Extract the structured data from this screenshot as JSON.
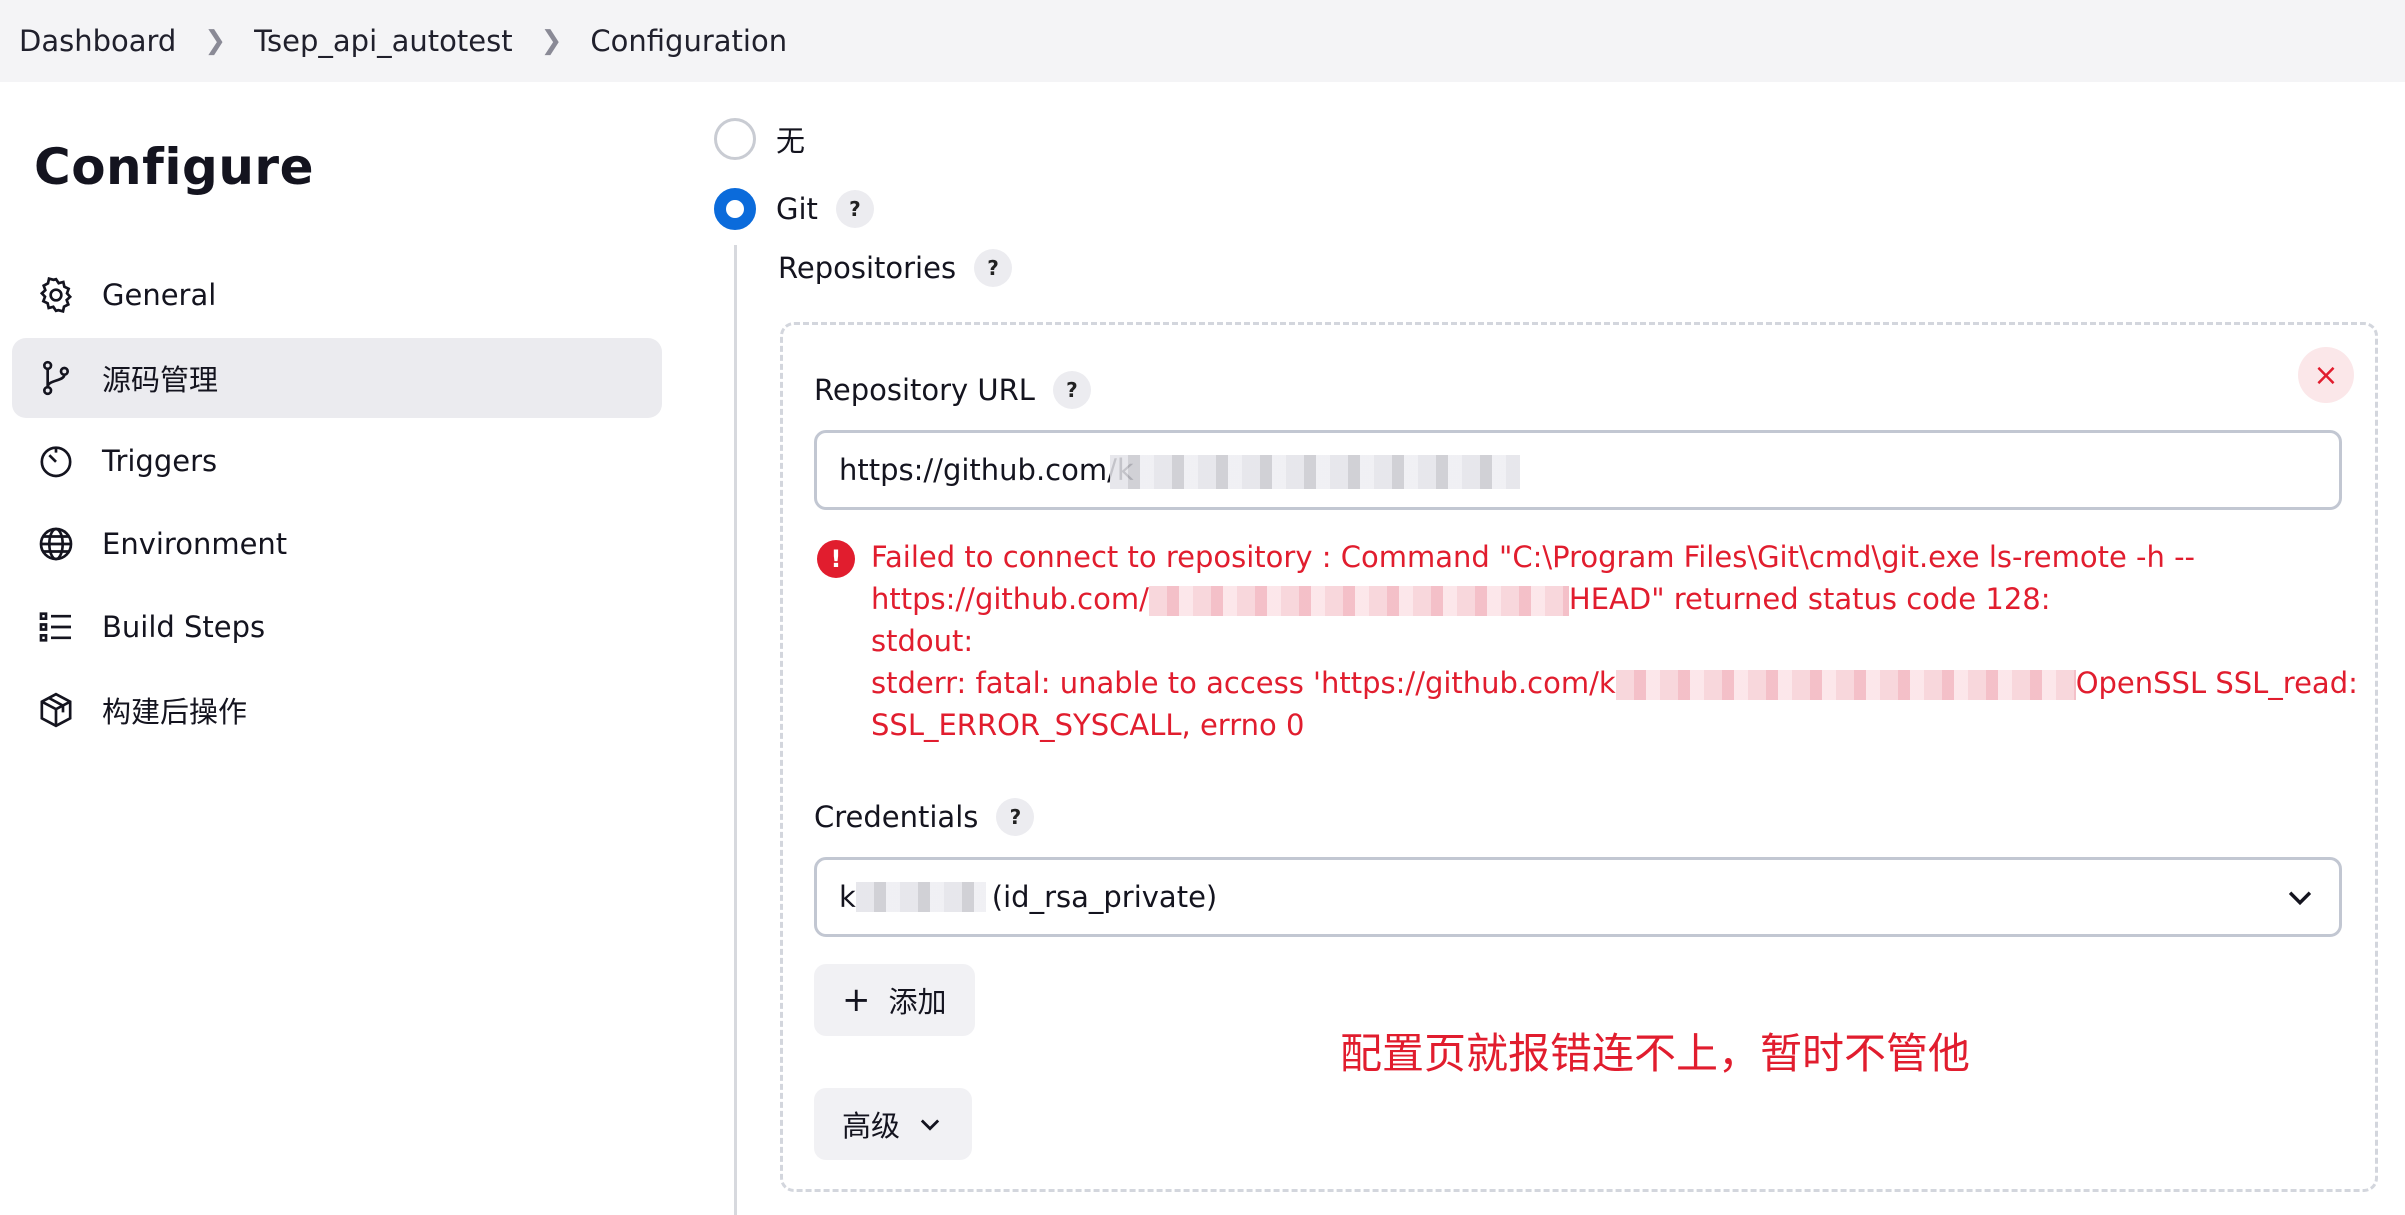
{
  "breadcrumb": [
    "Dashboard",
    "Tsep_api_autotest",
    "Configuration"
  ],
  "sidebar": {
    "title": "Configure",
    "items": [
      {
        "label": "General",
        "icon": "gear-icon"
      },
      {
        "label": "源码管理",
        "icon": "git-branch-icon",
        "active": true
      },
      {
        "label": "Triggers",
        "icon": "timer-icon"
      },
      {
        "label": "Environment",
        "icon": "globe-icon"
      },
      {
        "label": "Build Steps",
        "icon": "list-icon"
      },
      {
        "label": "构建后操作",
        "icon": "package-icon"
      }
    ]
  },
  "scm": {
    "options": [
      {
        "label": "无",
        "selected": false
      },
      {
        "label": "Git",
        "selected": true
      }
    ],
    "help": "?",
    "repositories_label": "Repositories",
    "repository_url_label": "Repository URL",
    "repository_url_value": "https://github.com/k",
    "error_lines": [
      "Failed to connect to repository : Command \"C:\\Program Files\\Git\\cmd\\git.exe ls-remote -h --",
      "https://github.com/",
      "HEAD\" returned status code 128:",
      "stdout:",
      "stderr: fatal: unable to access 'https://github.com/k",
      "OpenSSL SSL_read:",
      "SSL_ERROR_SYSCALL, errno 0"
    ],
    "credentials_label": "Credentials",
    "credentials_value": "(id_rsa_private)",
    "credentials_prefix": "k",
    "add_button": "添加",
    "add_icon": "+",
    "advanced_button": "高级",
    "close_icon": "×",
    "error_icon": "!"
  },
  "annotation": "配置页就报错连不上，暂时不管他",
  "colors": {
    "accent": "#0b6bdb",
    "error": "#e11d2e"
  }
}
